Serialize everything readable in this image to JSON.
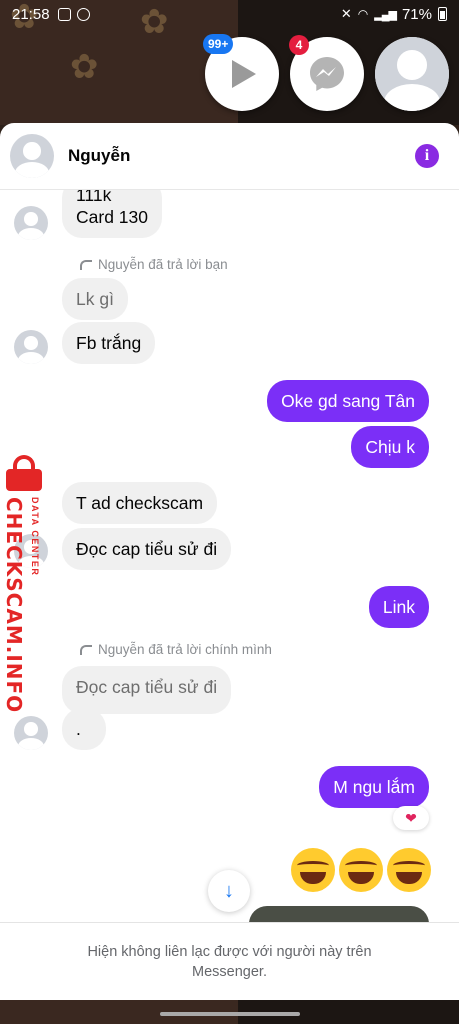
{
  "status_bar": {
    "time": "21:58",
    "battery": "71%"
  },
  "chatheads": [
    {
      "name": "video-chathead",
      "badge": "99+",
      "badge_color": "#1877f2"
    },
    {
      "name": "messenger-chathead",
      "badge": "4",
      "badge_color": "#e41e3f"
    },
    {
      "name": "profile-chathead"
    }
  ],
  "header": {
    "name": "Nguyễn",
    "info_icon": "i"
  },
  "messages": {
    "m1": "111k\nCard 130",
    "reply_note_1": "Nguyễn đã trả lời bạn",
    "m2": "Lk gì",
    "m3": "Fb trắng",
    "m4": "Oke gd sang Tân",
    "m5": "Chịu k",
    "m6": "T ad checkscam",
    "m7": "Đọc cap tiểu sử đi",
    "m8": "Link",
    "reply_note_2": "Nguyễn đã trả lời chính mình",
    "m9": "Đọc cap tiểu sử đi",
    "m10": ".",
    "m11": "M ngu lắm",
    "reaction": "❤",
    "emojis": [
      "laughing-emoji",
      "laughing-emoji",
      "laughing-emoji"
    ]
  },
  "footer": {
    "notice": "Hiện không liên lạc được với người này trên Messenger."
  },
  "watermark": {
    "main": "CHECKSCAM.INFO",
    "sub": "DATA CENTER"
  },
  "colors": {
    "accent": "#7b2ff7",
    "incoming": "#f0f0f0",
    "info": "#8a2be2",
    "watermark": "#e32626"
  }
}
